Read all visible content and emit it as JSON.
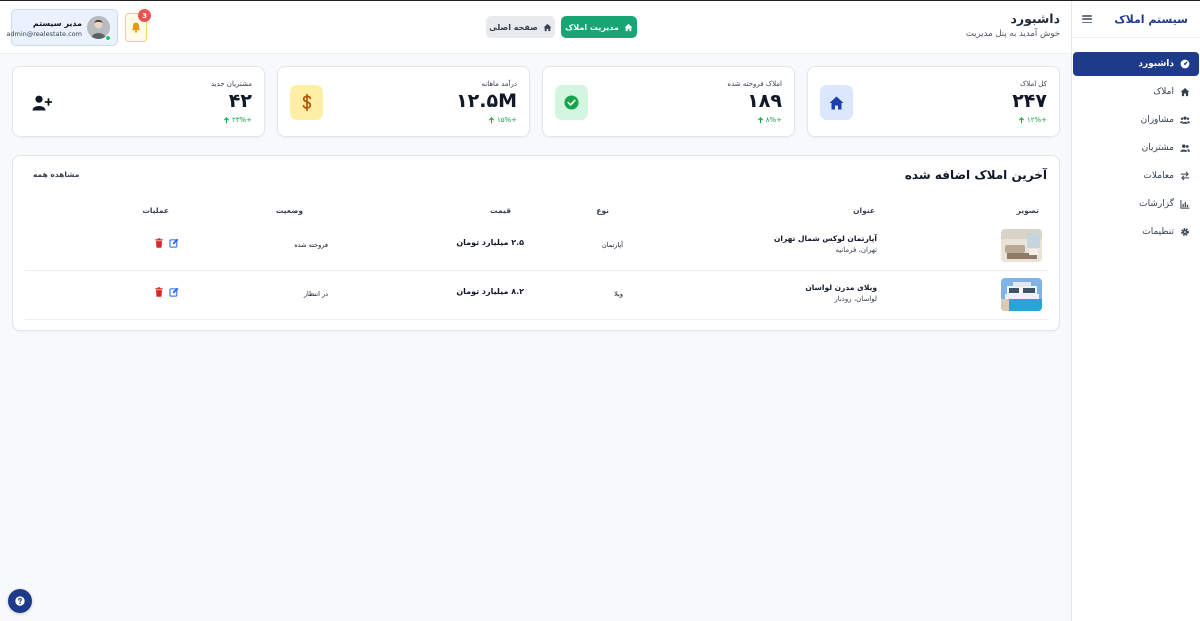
{
  "sidebar": {
    "brand": "سیستم املاک",
    "items": [
      {
        "label": "داشبورد",
        "icon": "dashboard-icon",
        "active": true
      },
      {
        "label": "املاک",
        "icon": "home-icon"
      },
      {
        "label": "مشاوران",
        "icon": "users-icon"
      },
      {
        "label": "مشتریان",
        "icon": "customers-icon"
      },
      {
        "label": "معاملات",
        "icon": "exchange-icon"
      },
      {
        "label": "گزارشات",
        "icon": "chart-icon"
      },
      {
        "label": "تنظیمات",
        "icon": "gear-icon"
      }
    ]
  },
  "header": {
    "title": "داشبورد",
    "subtitle": "خوش آمدید به پنل مدیریت",
    "manage_button": "مدیریت املاک",
    "home_button": "صفحه اصلی",
    "notification_count": "3",
    "user": {
      "name": "مدیر سیستم",
      "email": "admin@realestate.com"
    }
  },
  "stats": [
    {
      "label": "کل املاک",
      "value": "۲۴۷",
      "change": "۱۲%+",
      "icon": "home-icon",
      "color": "#1e40af",
      "bg": "#dbe7fb"
    },
    {
      "label": "املاک فروخته شده",
      "value": "۱۸۹",
      "change": "۸%+",
      "icon": "check-circle-icon",
      "color": "#16a34a",
      "bg": "#d4f5df"
    },
    {
      "label": "درآمد ماهانه",
      "value": "۱۲.۵M",
      "change": "۱۵%+",
      "icon": "dollar-icon",
      "color": "#b45309",
      "bg": "#fdf0a6"
    },
    {
      "label": "مشتریان جدید",
      "value": "۴۲",
      "change": "۲۳%+",
      "icon": "user-plus-icon",
      "color": "#111827",
      "bg": "transparent"
    }
  ],
  "recent": {
    "title": "آخرین املاک اضافه شده",
    "view_all": "مشاهده همه",
    "columns": [
      "تصویر",
      "عنوان",
      "نوع",
      "قیمت",
      "وضعیت",
      "عملیات"
    ],
    "rows": [
      {
        "title": "آپارتمان لوکس شمال تهران",
        "location": "تهران، فرمانیه",
        "type": "آپارتمان",
        "price": "۲.۵ میلیارد تومان",
        "status": "فروخته شده"
      },
      {
        "title": "ویلای مدرن لواسان",
        "location": "لواسان، رودبار",
        "type": "ویلا",
        "price": "۸.۲ میلیارد تومان",
        "status": "در انتظار"
      }
    ]
  },
  "colors": {
    "primary": "#1e3a8a",
    "success": "#17a673",
    "danger": "#dc2626",
    "edit": "#2563eb"
  }
}
